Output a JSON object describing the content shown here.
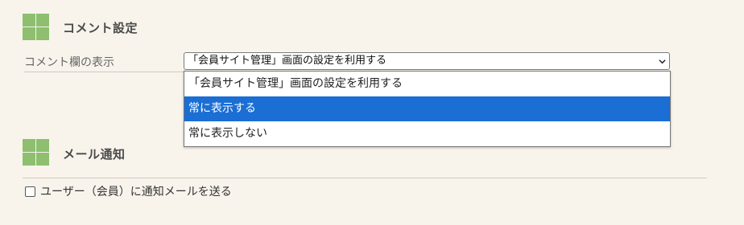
{
  "comment_section": {
    "title": "コメント設定",
    "icon": "grid-icon",
    "field_label": "コメント欄の表示",
    "select": {
      "selected_value": "「会員サイト管理」画面の設定を利用する",
      "options": [
        "「会員サイト管理」画面の設定を利用する",
        "常に表示する",
        "常に表示しない"
      ],
      "highlighted_option": "常に表示する"
    }
  },
  "mail_section": {
    "title": "メール通知",
    "icon": "grid-icon",
    "checkbox_label": "ユーザー（会員）に通知メールを送る",
    "checkbox_checked": false
  },
  "colors": {
    "background": "#f8f4ec",
    "icon_green": "#8dbf6f",
    "highlight": "#1a6ed4"
  }
}
